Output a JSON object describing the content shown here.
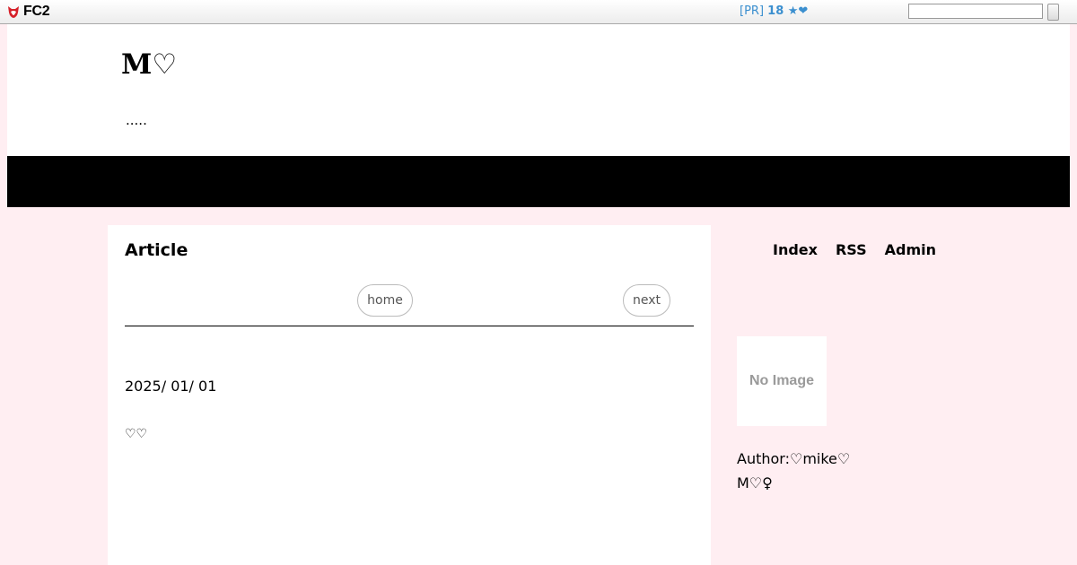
{
  "fc2bar": {
    "logo_text": "FC2",
    "pr_prefix": "[PR]",
    "pr_link": "18 ★❤",
    "search_placeholder": ""
  },
  "header": {
    "blog_title": "M♡",
    "description": "....."
  },
  "main": {
    "title": "Article",
    "home_label": "home",
    "next_label": "next",
    "post_date": "2025/ 01/ 01",
    "post_body": "♡♡"
  },
  "sidebar": {
    "menu": [
      "Index",
      "RSS",
      "Admin"
    ],
    "no_image_text": "No Image",
    "author": "Author:♡mike♡",
    "author_sub": "M♡♀"
  },
  "colors": {
    "page_bg": "#ffeef2",
    "nav_bar": "#000000",
    "pr_link": "#3b8fcf",
    "fc2_logo_red": "#d6212a"
  }
}
